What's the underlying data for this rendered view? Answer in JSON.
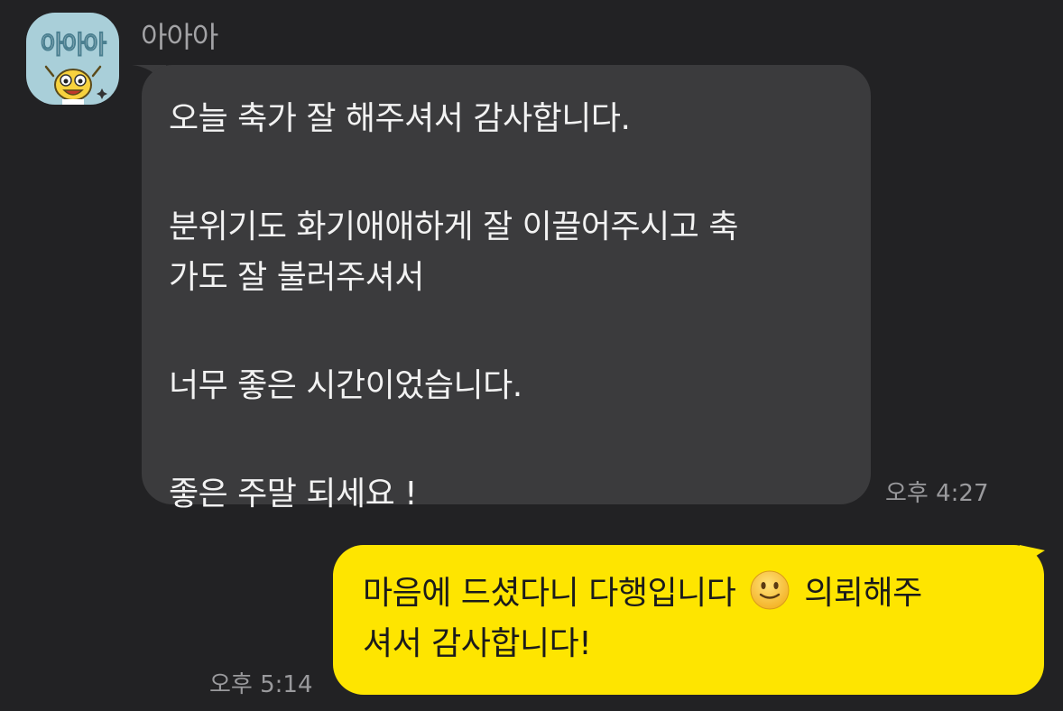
{
  "chat": {
    "incoming": {
      "avatar_text": "아아아",
      "sender": "아아아",
      "lines": {
        "l1": "오늘 축가 잘 해주셔서 감사합니다.",
        "l2": "분위기도 화기애애하게 잘 이끌어주시고 축",
        "l3": "가도 잘 불러주셔서",
        "l4": "너무 좋은 시간이었습니다.",
        "l5": "좋은 주말 되세요 !"
      },
      "time": "오후 4:27",
      "bubble_color": "#3b3b3d"
    },
    "outgoing": {
      "line1_before": "마음에 드셨다니 다행입니다",
      "emoji": "slightly-smiling-face-icon",
      "line1_after": "의뢰해주",
      "line2": "셔서 감사합니다!",
      "time": "오후 5:14",
      "bubble_color": "#fee500"
    }
  }
}
